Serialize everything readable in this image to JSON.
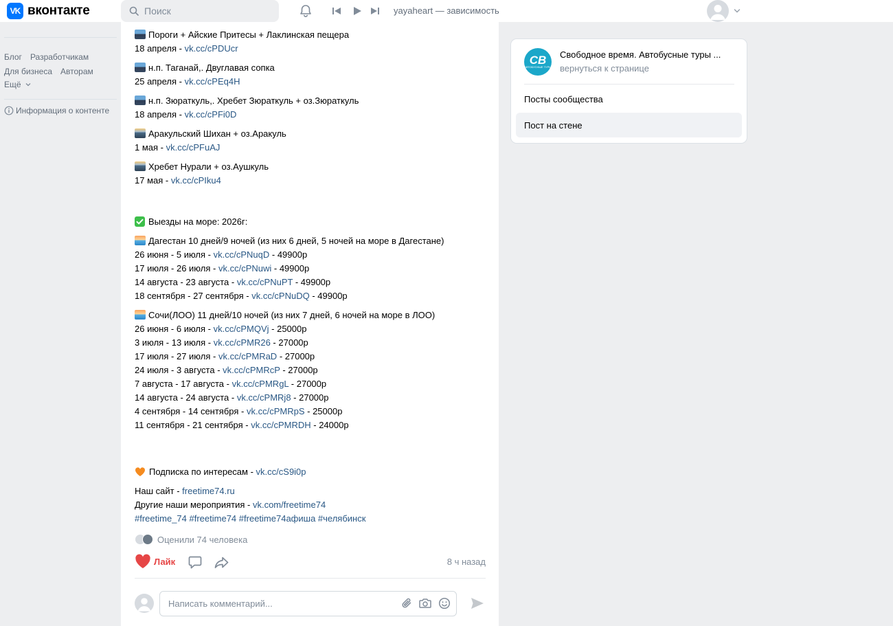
{
  "header": {
    "logo_mark": "VK",
    "logo_text": "вконтакте",
    "search_placeholder": "Поиск",
    "now_playing": "yayaheart — зависимость"
  },
  "left_nav": {
    "footer_links": [
      [
        "Блог",
        "Разработчикам"
      ],
      [
        "Для бизнеса",
        "Авторам"
      ]
    ],
    "more": "Ещё",
    "content_info": "Информация о контенте"
  },
  "post": {
    "tours": [
      {
        "name": "Пороги + Айские Притесы + Лаклинская пещера",
        "date": "18 апреля",
        "link": "vk.cc/cPDUcr",
        "emoji": "mountain"
      },
      {
        "name": "н.п. Таганай,. Двуглавая сопка",
        "date": "25 апреля",
        "link": "vk.cc/cPEq4H",
        "emoji": "mountain"
      },
      {
        "name": "н.п. Зюраткуль,. Хребет Зюраткуль + оз.Зюраткуль",
        "date": "18 апреля",
        "link": "vk.cc/cPFi0D",
        "emoji": "mountain"
      },
      {
        "name": "Аракульский Шихан + оз.Аракуль",
        "date": "1 мая",
        "link": "vk.cc/cPFuAJ",
        "emoji": "mountain-sunrise"
      },
      {
        "name": "Хребет Нурали + оз.Аушкуль",
        "date": "17 мая",
        "link": "vk.cc/cPIku4",
        "emoji": "mountain-sunrise"
      }
    ],
    "sea_heading": "Выезды на море: 2026г:",
    "sea_trips": [
      {
        "title": "Дагестан 10 дней/9 ночей (из них 6 дней, 5 ночей на море в Дагестане)",
        "rows": [
          {
            "dates": "26 июня - 5 июля",
            "link": "vk.cc/cPNuqD",
            "price": "49900р"
          },
          {
            "dates": "17 июля - 26 июля",
            "link": "vk.cc/cPNuwi",
            "price": "49900р"
          },
          {
            "dates": "14 августа - 23 августа",
            "link": "vk.cc/cPNuPT",
            "price": "49900р"
          },
          {
            "dates": "18 сентября - 27 сентября",
            "link": "vk.cc/cPNuDQ",
            "price": "49900р"
          }
        ]
      },
      {
        "title": "Сочи(ЛОО) 11 дней/10 ночей (из них 7 дней, 6 ночей на море в ЛОО)",
        "rows": [
          {
            "dates": "26 июня - 6 июля",
            "link": "vk.cc/cPMQVj",
            "price": "25000р"
          },
          {
            "dates": "3 июля - 13 июля",
            "link": "vk.cc/cPMR26",
            "price": "27000р"
          },
          {
            "dates": "17 июля - 27 июля",
            "link": "vk.cc/cPMRaD",
            "price": "27000р"
          },
          {
            "dates": "24 июля - 3 августа",
            "link": "vk.cc/cPMRcP",
            "price": "27000р"
          },
          {
            "dates": "7 августа - 17 августа",
            "link": "vk.cc/cPMRgL",
            "price": "27000р"
          },
          {
            "dates": "14 августа - 24 августа",
            "link": "vk.cc/cPMRj8",
            "price": "27000р"
          },
          {
            "dates": "4 сентября - 14 сентября",
            "link": "vk.cc/cPMRpS",
            "price": "25000р"
          },
          {
            "dates": "11 сентября - 21 сентября",
            "link": "vk.cc/cPMRDH",
            "price": "24000р"
          }
        ]
      }
    ],
    "subscription_text": "Подписка по интересам",
    "subscription_link": "vk.cc/cS9i0p",
    "site_label": "Наш сайт",
    "site_link": "freetime74.ru",
    "other_label": "Другие наши мероприятия",
    "other_link": "vk.com/freetime74",
    "hashtags": [
      "#freetime_74",
      "#freetime74",
      "#freetime74афиша",
      "#челябинск"
    ],
    "likers_text": "Оценили 74 человека",
    "like_label": "Лайк",
    "time": "8 ч назад",
    "comment_placeholder": "Написать комментарий..."
  },
  "right_panel": {
    "group_logo_text": "СВ",
    "group_logo_sub": "АВТОБУСНЫЕ ТУРЫ",
    "group_name": "Свободное время. Автобусные туры ...",
    "back_link": "вернуться к странице",
    "menu": [
      {
        "label": "Посты сообщества",
        "active": false
      },
      {
        "label": "Пост на стене",
        "active": true
      }
    ]
  },
  "colors": {
    "link": "#2a5885",
    "like": "#e64646",
    "brand": "#0077ff",
    "page_bg": "#edeef0"
  }
}
